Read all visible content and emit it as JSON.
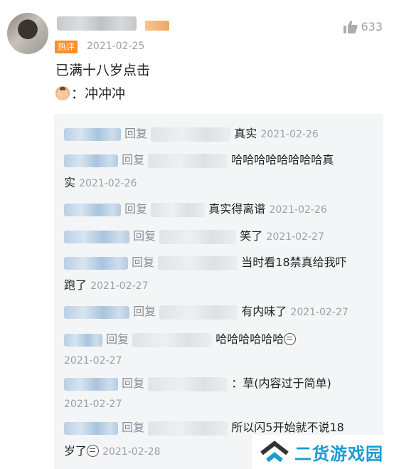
{
  "comment": {
    "likes": "633",
    "hot_tag": "热评",
    "date": "2021-02-25",
    "line1": "已满十八岁点击",
    "line2": "：冲冲冲"
  },
  "replies": {
    "word": "回复",
    "items": [
      {
        "text": "真实",
        "date": "2021-02-26"
      },
      {
        "text": "哈哈哈哈哈哈哈哈真",
        "cont": "实",
        "date": "2021-02-26"
      },
      {
        "text": "真实得离谱",
        "date": "2021-02-26"
      },
      {
        "text": "笑了",
        "date": "2021-02-27"
      },
      {
        "text": "当时看18禁真给我吓",
        "cont": "跑了",
        "date": "2021-02-27"
      },
      {
        "text": "有内味了",
        "date": "2021-02-27"
      },
      {
        "text": "哈哈哈哈哈哈",
        "date": "2021-02-27"
      },
      {
        "text": "：草(内容过于简单)",
        "date": "2021-02-27"
      },
      {
        "text": "所以闪5开始就不说18",
        "cont": "岁了",
        "date": "2021-02-28"
      }
    ]
  },
  "watermark": {
    "text": "二货游戏园"
  }
}
